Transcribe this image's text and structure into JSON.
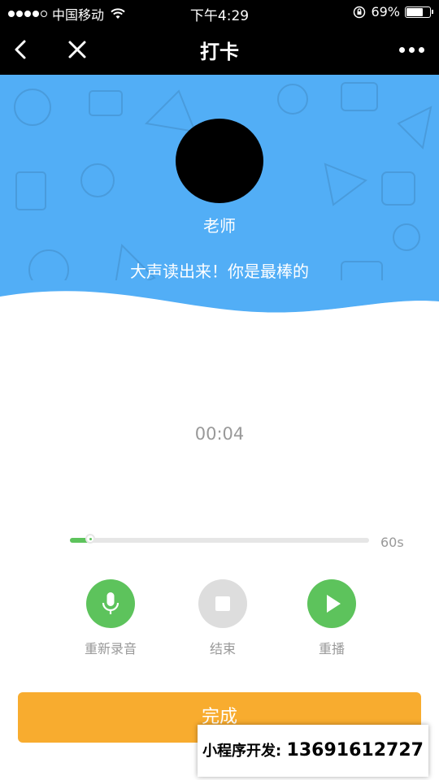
{
  "status_bar": {
    "carrier": "中国移动",
    "time": "下午4:29",
    "battery_percent": "69%",
    "battery_level": 0.69
  },
  "nav": {
    "title": "打卡"
  },
  "hero": {
    "teacher_name": "老师",
    "message": "大声读出来！你是最棒的"
  },
  "recorder": {
    "elapsed": "00:04",
    "max_label": "60s",
    "progress": 0.067
  },
  "controls": {
    "rerecord_label": "重新录音",
    "stop_label": "结束",
    "replay_label": "重播"
  },
  "done_label": "完成",
  "watermark": {
    "label": "小程序开发:",
    "phone": "13691612727"
  },
  "colors": {
    "hero_blue": "#52aef6",
    "green": "#5dc35c",
    "gray_button": "#dddddd",
    "done_orange": "#f8ac2f"
  }
}
